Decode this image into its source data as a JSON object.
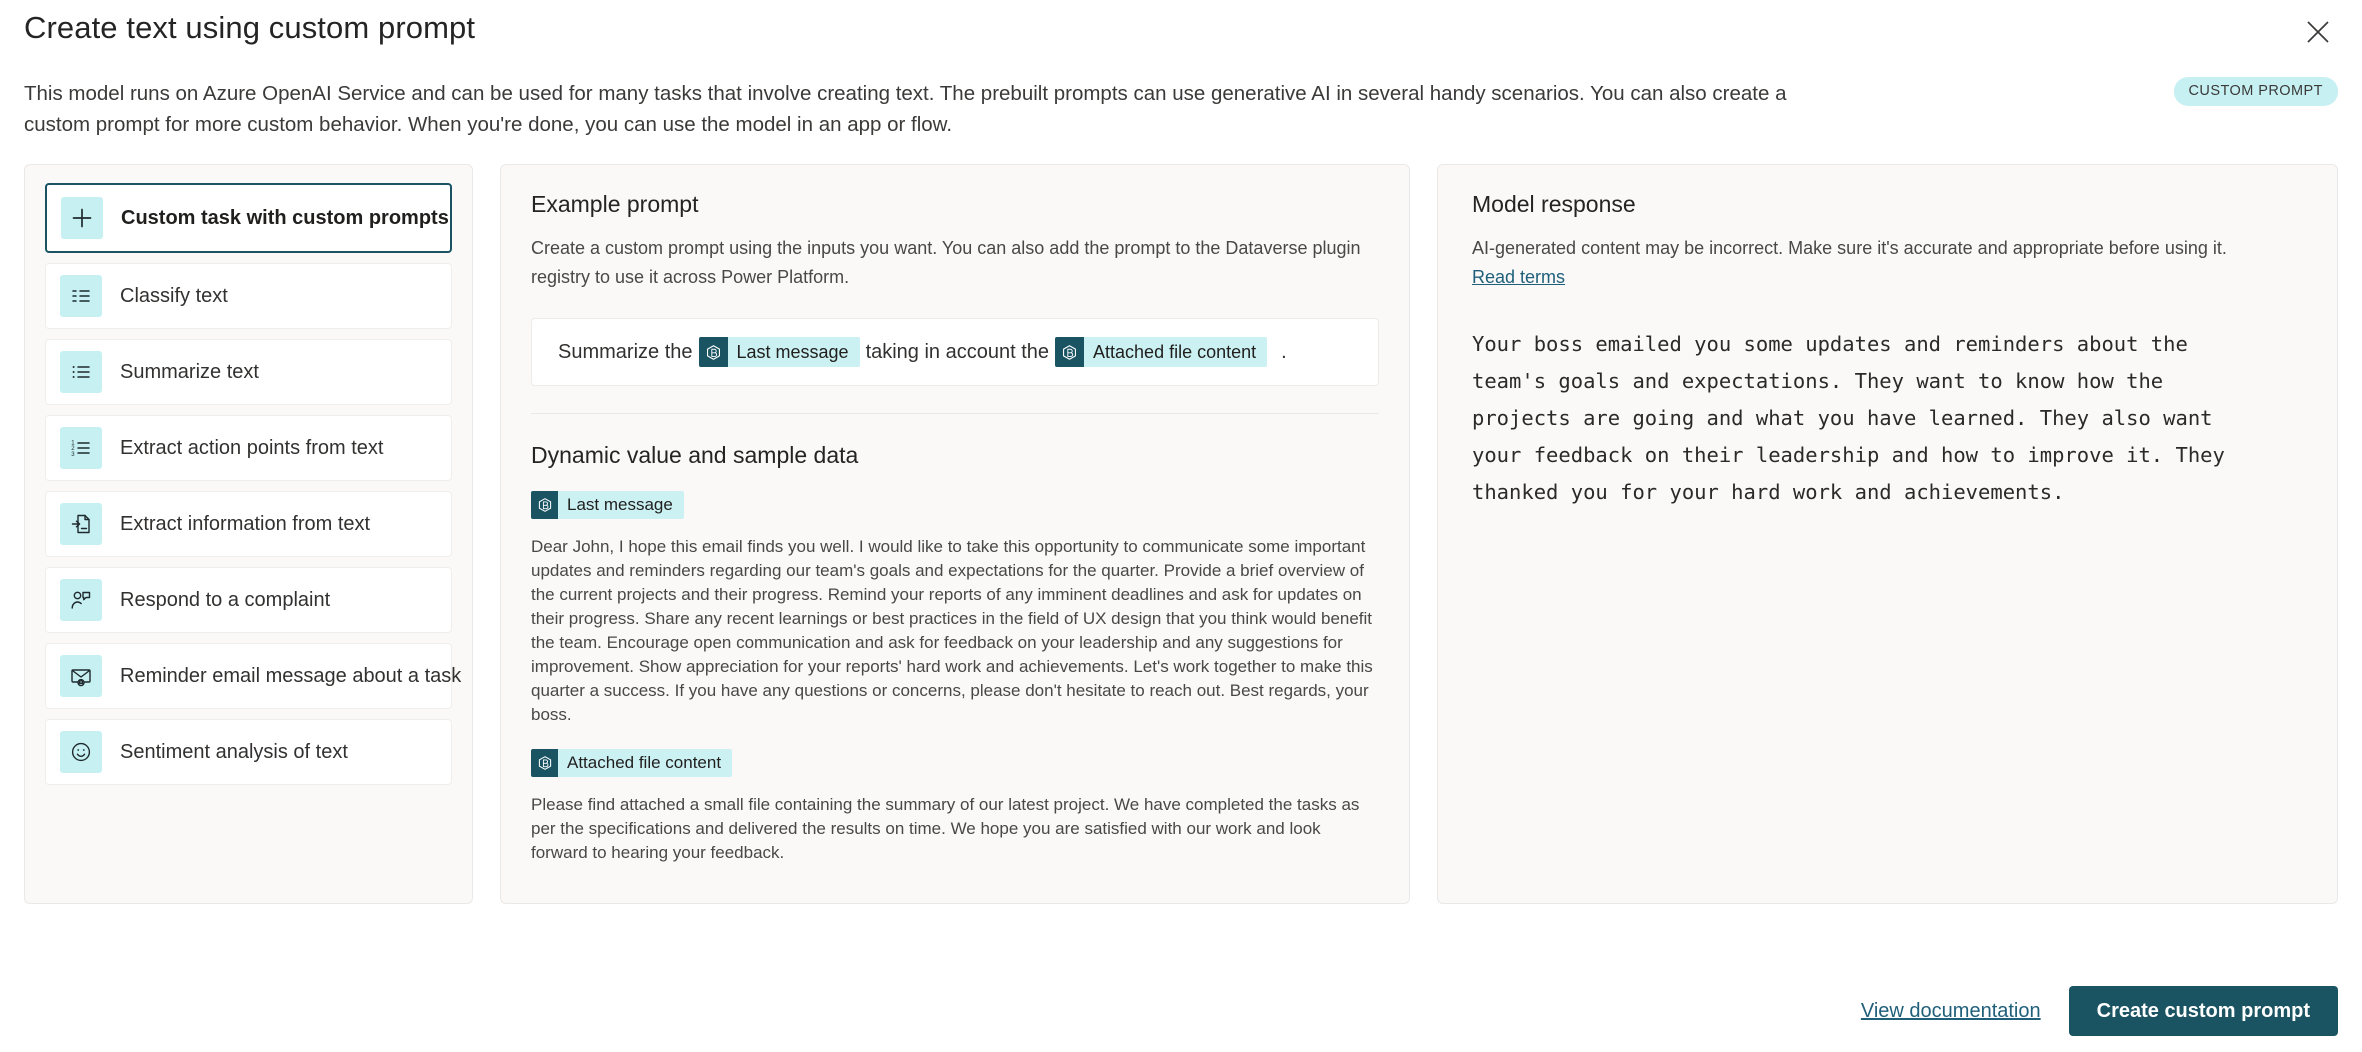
{
  "header": {
    "title": "Create text using custom prompt",
    "intro": "This model runs on Azure OpenAI Service and can be used for many tasks that involve creating text. The prebuilt prompts can use generative AI in several handy scenarios. You can also create a custom prompt for more custom behavior. When you're done, you can use the model in an app or flow.",
    "badge": "CUSTOM PROMPT",
    "close_icon": "close-icon"
  },
  "sidebar": {
    "items": [
      {
        "label": "Custom task with custom prompts",
        "icon": "plus-icon",
        "selected": true
      },
      {
        "label": "Classify text",
        "icon": "classify-list-icon",
        "selected": false
      },
      {
        "label": "Summarize text",
        "icon": "bulleted-list-icon",
        "selected": false
      },
      {
        "label": "Extract action points from text",
        "icon": "numbered-list-icon",
        "selected": false
      },
      {
        "label": "Extract information from text",
        "icon": "document-extract-icon",
        "selected": false
      },
      {
        "label": "Respond to a complaint",
        "icon": "person-reply-icon",
        "selected": false
      },
      {
        "label": "Reminder email message about a task",
        "icon": "mail-reminder-icon",
        "selected": false
      },
      {
        "label": "Sentiment analysis of text",
        "icon": "smiley-face-icon",
        "selected": false
      }
    ]
  },
  "example_prompt": {
    "title": "Example prompt",
    "description": "Create a custom prompt using the inputs you want. You can also add the prompt to the Dataverse plugin registry to use it across Power Platform.",
    "prompt_prefix": "Summarize the",
    "chip_one": "Last message",
    "prompt_middle": "taking in account the",
    "chip_two": "Attached file content",
    "prompt_suffix": "."
  },
  "dynamic_values": {
    "title": "Dynamic value and sample data",
    "entries": [
      {
        "chip": "Last message",
        "text": "Dear John, I hope this email finds you well. I would like to take this opportunity to communicate some important updates and reminders regarding our team's goals and expectations for the quarter. Provide a brief overview of the current projects and their progress. Remind your reports of any imminent deadlines and ask for updates on their progress. Share any recent learnings or best practices in the field of UX design that you think would benefit the team. Encourage open communication and ask for feedback on your leadership and any suggestions for improvement. Show appreciation for your reports' hard work and achievements. Let's work together to make this quarter a success. If you have any questions or concerns, please don't hesitate to reach out. Best regards, your boss."
      },
      {
        "chip": "Attached file content",
        "text": "Please find attached a small file containing the summary of our latest project. We have completed the tasks as per the specifications and delivered the results on time. We hope you are satisfied with our work and look forward to hearing your feedback."
      }
    ]
  },
  "model_response": {
    "title": "Model response",
    "disclaimer": "AI-generated content may be incorrect. Make sure it's accurate and appropriate before using it. ",
    "terms_link": "Read terms",
    "output": "Your boss emailed you some updates and reminders about the team's goals and expectations. They want to know how the projects are going and what you have learned. They also want your feedback on their leadership and how to improve it. They thanked you for your hard work and achievements."
  },
  "footer": {
    "documentation_link": "View documentation",
    "primary_button": "Create custom prompt"
  },
  "colors": {
    "accent": "#1a5463",
    "chip_bg": "#ccf1f3",
    "badge_bg": "#c7f0f2",
    "link": "#1f5f7a",
    "panel_bg": "#faf9f8"
  }
}
